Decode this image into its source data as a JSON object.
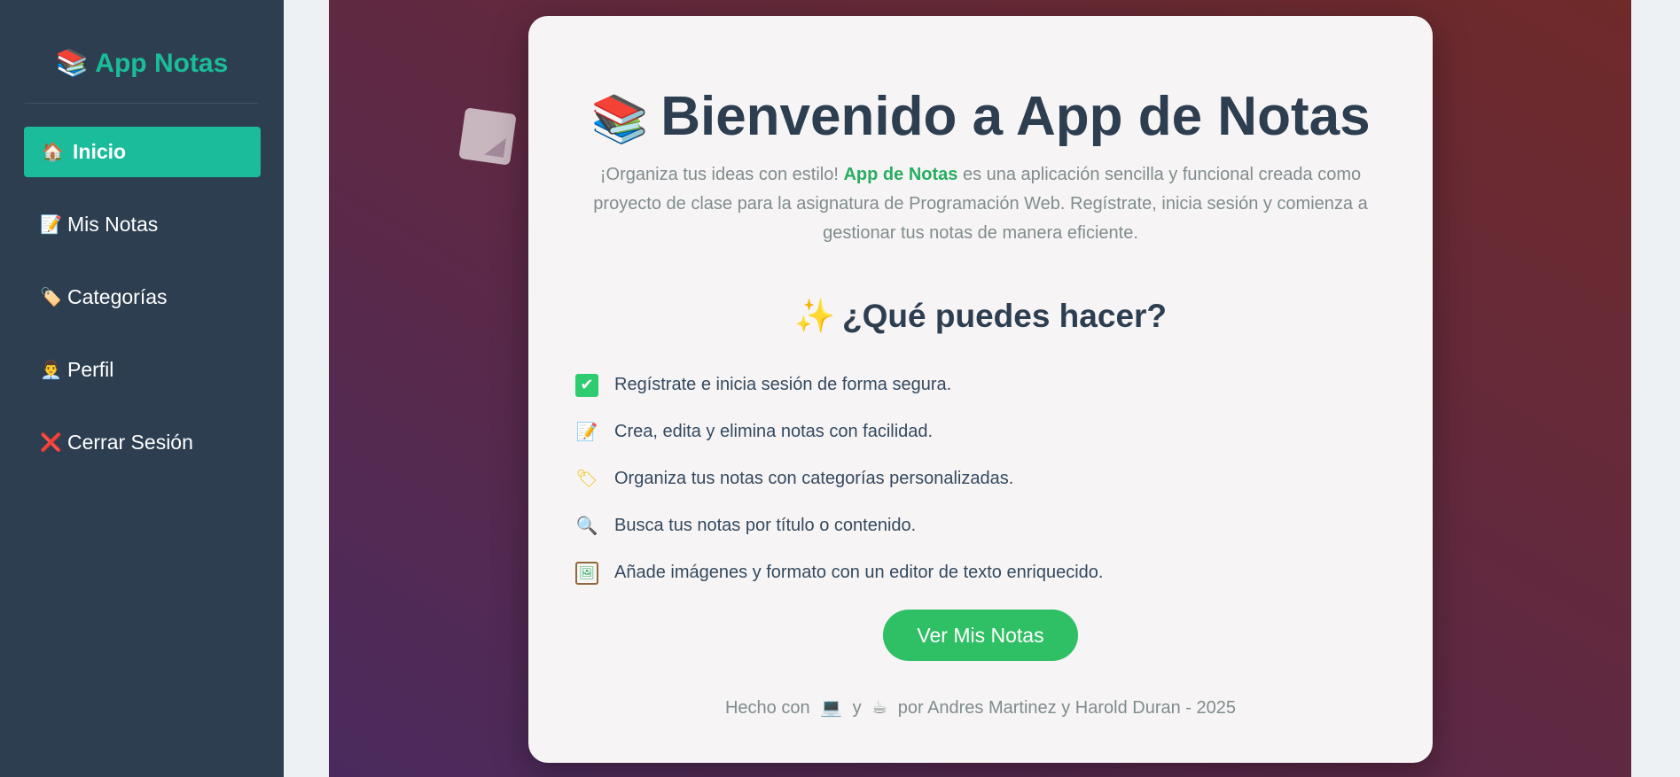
{
  "sidebar": {
    "brand": {
      "icon": "📚",
      "label": "App Notas"
    },
    "items": [
      {
        "icon": "🏠",
        "label": "Inicio",
        "active": true
      },
      {
        "icon": "📝",
        "label": "Mis Notas",
        "active": false
      },
      {
        "icon": "🏷️",
        "label": "Categorías",
        "active": false
      },
      {
        "icon": "👨‍💼",
        "label": "Perfil",
        "active": false
      },
      {
        "icon": "❌",
        "label": "Cerrar Sesión",
        "active": false
      }
    ]
  },
  "main": {
    "title_icon": "📚",
    "title": "Bienvenido a App de Notas",
    "intro_before": "¡Organiza tus ideas con estilo! ",
    "intro_highlight": "App de Notas",
    "intro_after": " es una aplicación sencilla y funcional creada como proyecto de clase para la asignatura de Programación Web. Regístrate, inicia sesión y comienza a gestionar tus notas de manera eficiente.",
    "subtitle_icon": "✨",
    "subtitle": "¿Qué puedes hacer?",
    "features": [
      {
        "icon": "✔",
        "text": "Regístrate e inicia sesión de forma segura."
      },
      {
        "icon": "📝",
        "text": "Crea, edita y elimina notas con facilidad."
      },
      {
        "icon": "🏷",
        "text": "Organiza tus notas con categorías personalizadas."
      },
      {
        "icon": "🔍",
        "text": "Busca tus notas por título o contenido."
      },
      {
        "icon": "🖼",
        "text": "Añade imágenes y formato con un editor de texto enriquecido."
      }
    ],
    "cta_label": "Ver Mis Notas",
    "footer": {
      "before": "Hecho con",
      "icon1": "💻",
      "middle": "y",
      "icon2": "☕",
      "after": "por Andres Martinez y Harold Duran - 2025"
    }
  },
  "colors": {
    "sidebar_bg": "#2c3e50",
    "accent": "#1abc9c",
    "cta": "#2fbf64",
    "title": "#2c3e50"
  }
}
